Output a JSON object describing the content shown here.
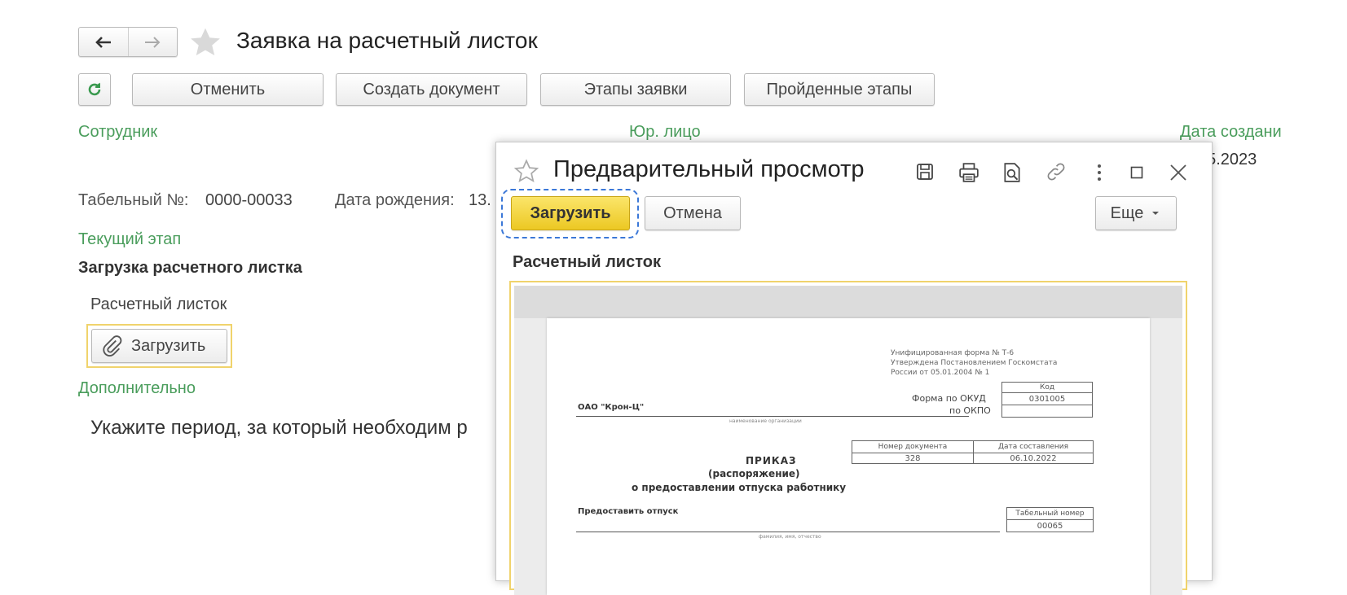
{
  "window": {
    "title": "Заявка на расчетный листок",
    "nav": {
      "back_icon": "arrow-left-icon",
      "forward_icon": "arrow-right-icon",
      "favorite_icon": "star-icon"
    }
  },
  "toolbar": {
    "refresh_icon": "refresh-icon",
    "cancel_label": "Отменить",
    "create_document_label": "Создать документ",
    "stages_label": "Этапы заявки",
    "passed_stages_label": "Пройденные этапы"
  },
  "form": {
    "employee_label": "Сотрудник",
    "legal_entity_label": "Юр. лицо",
    "creation_date_label": "Дата создани",
    "creation_date_value": "05.2023",
    "tab_number_label": "Табельный №:",
    "tab_number_value": "0000-00033",
    "birth_date_label": "Дата рождения:",
    "birth_date_value": "13.",
    "current_stage_label": "Текущий этап",
    "current_stage_value": "Загрузка расчетного листка",
    "payslip_label": "Расчетный листок",
    "upload_label": "Загрузить",
    "additional_label": "Дополнительно",
    "period_text": "Укажите период, за который необходим р"
  },
  "dialog": {
    "title": "Предварительный просмотр",
    "upload_label": "Загрузить",
    "cancel_label": "Отмена",
    "more_label": "Еще",
    "section_label": "Расчетный листок"
  },
  "document": {
    "header_lines": [
      "Унифицированная форма № Т-6",
      "Утверждена Постановлением Госкомстата",
      "России от 05.01.2004 № 1"
    ],
    "code_label": "Код",
    "okud_label": "Форма по ОКУД",
    "okud_value": "0301005",
    "okpo_label": "по ОКПО",
    "organization": "ОАО \"Крон-Ц\"",
    "organization_caption": "наименование организации",
    "doc_number_label": "Номер документа",
    "doc_date_label": "Дата составления",
    "doc_number_value": "328",
    "doc_date_value": "06.10.2022",
    "title_line1": "ПРИКАЗ",
    "title_line2": "(распоряжение)",
    "title_line3": "о предоставлении отпуска работнику",
    "grant_leave": "Предоставить отпуск",
    "tab_number_label": "Табельный номер",
    "tab_number_value": "00065",
    "name_caption": "фамилия, имя, отчество"
  },
  "colors": {
    "accent_green": "#4a9d5c",
    "primary_button": "#f2d335",
    "highlight_border": "#f0d36c",
    "focus_dash": "#3b78d8"
  }
}
